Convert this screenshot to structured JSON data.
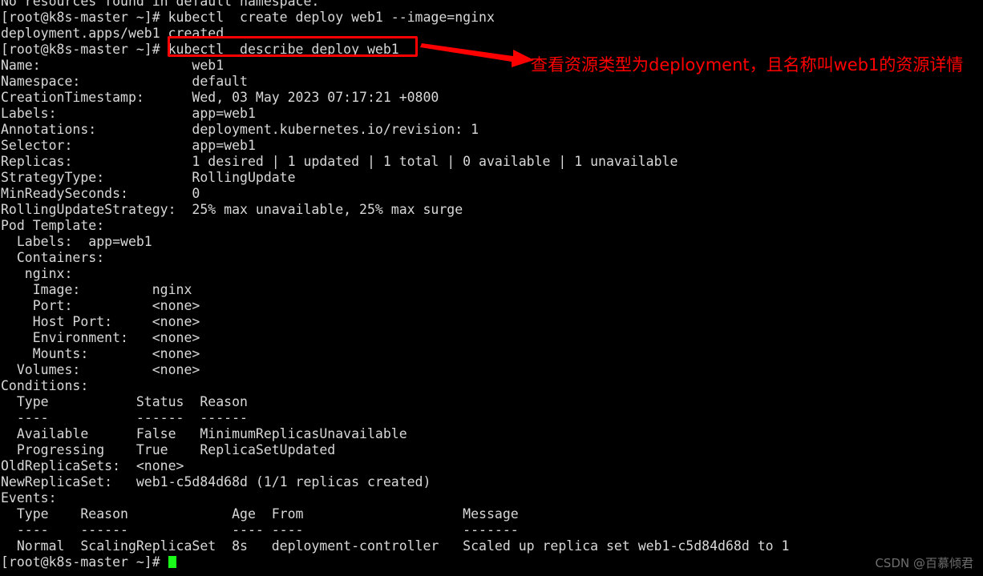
{
  "terminal": {
    "prompt": "[root@k8s-master ~]#",
    "cursor_color": "#1bfc1b",
    "foreground_color": "#d8d8d8",
    "background_color": "#000000",
    "lines": [
      "No resources found in default namespace.",
      "[root@k8s-master ~]# kubectl  create deploy web1 --image=nginx",
      "deployment.apps/web1 created",
      "[root@k8s-master ~]# kubectl  describe deploy web1",
      "Name:                   web1",
      "Namespace:              default",
      "CreationTimestamp:      Wed, 03 May 2023 07:17:21 +0800",
      "Labels:                 app=web1",
      "Annotations:            deployment.kubernetes.io/revision: 1",
      "Selector:               app=web1",
      "Replicas:               1 desired | 1 updated | 1 total | 0 available | 1 unavailable",
      "StrategyType:           RollingUpdate",
      "MinReadySeconds:        0",
      "RollingUpdateStrategy:  25% max unavailable, 25% max surge",
      "Pod Template:",
      "  Labels:  app=web1",
      "  Containers:",
      "   nginx:",
      "    Image:         nginx",
      "    Port:          <none>",
      "    Host Port:     <none>",
      "    Environment:   <none>",
      "    Mounts:        <none>",
      "  Volumes:         <none>",
      "Conditions:",
      "  Type           Status  Reason",
      "  ----           ------  ------",
      "  Available      False   MinimumReplicasUnavailable",
      "  Progressing    True    ReplicaSetUpdated",
      "OldReplicaSets:  <none>",
      "NewReplicaSet:   web1-c5d84d68d (1/1 replicas created)",
      "Events:",
      "  Type    Reason             Age  From                    Message",
      "  ----    ------             ---- ----                    -------",
      "  Normal  ScalingReplicaSet  8s   deployment-controller   Scaled up replica set web1-c5d84d68d to 1"
    ],
    "last_prompt_line": "[root@k8s-master ~]# "
  },
  "commands": {
    "create_command": "kubectl  create deploy web1 --image=nginx",
    "create_result": "deployment.apps/web1 created",
    "highlighted_command": "kubectl  describe deploy web1"
  },
  "deployment": {
    "name": "web1",
    "namespace": "default",
    "creation_timestamp": "Wed, 03 May 2023 07:17:21 +0800",
    "labels": "app=web1",
    "annotations": "deployment.kubernetes.io/revision: 1",
    "selector": "app=web1",
    "replicas": "1 desired | 1 updated | 1 total | 0 available | 1 unavailable",
    "strategy_type": "RollingUpdate",
    "min_ready_seconds": "0",
    "rolling_update_strategy": "25% max unavailable, 25% max surge",
    "old_replica_sets": "<none>",
    "new_replica_set": "web1-c5d84d68d (1/1 replicas created)",
    "pod_template": {
      "labels": "app=web1",
      "container_name": "nginx",
      "image": "nginx",
      "port": "<none>",
      "host_port": "<none>",
      "environment": "<none>",
      "mounts": "<none>",
      "volumes": "<none>"
    },
    "conditions": {
      "headers": [
        "Type",
        "Status",
        "Reason"
      ],
      "rows": [
        [
          "Available",
          "False",
          "MinimumReplicasUnavailable"
        ],
        [
          "Progressing",
          "True",
          "ReplicaSetUpdated"
        ]
      ]
    },
    "events": {
      "headers": [
        "Type",
        "Reason",
        "Age",
        "From",
        "Message"
      ],
      "rows": [
        [
          "Normal",
          "ScalingReplicaSet",
          "8s",
          "deployment-controller",
          "Scaled up replica set web1-c5d84d68d to 1"
        ]
      ]
    }
  },
  "annotation": {
    "caption": "查看资源类型为deployment，且名称叫web1的资源详情",
    "color": "#ff0000"
  },
  "watermark": {
    "text": "CSDN @百慕倾君"
  }
}
